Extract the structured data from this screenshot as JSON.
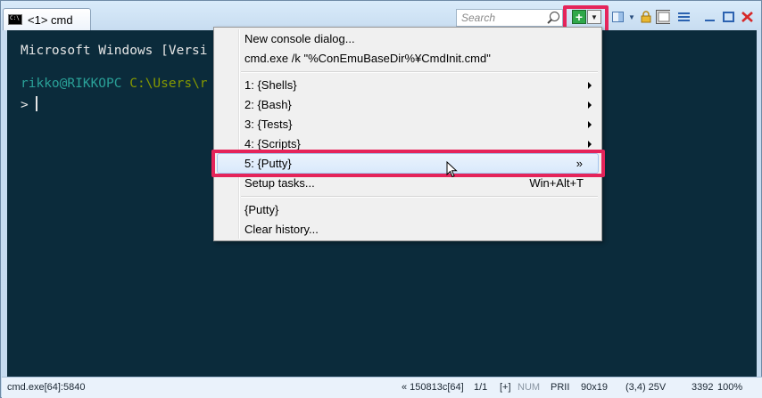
{
  "window": {
    "tab_label": "<1> cmd",
    "search_placeholder": "Search"
  },
  "console": {
    "lines": [
      {
        "text": "Microsoft Windows [Versi",
        "color": "#e6e6e6"
      },
      {
        "user": "rikko@RIKKOPC",
        "path": "C:\\Users\\r",
        "user_color": "#2aa198",
        "path_color": "#859900"
      },
      {
        "text": "> ",
        "color": "#e6e6e6"
      }
    ]
  },
  "menu": {
    "items": [
      {
        "label": "New console dialog..."
      },
      {
        "label": "cmd.exe /k \"%ConEmuBaseDir%¥CmdInit.cmd\""
      },
      {
        "label": "1: {Shells}"
      },
      {
        "label": "2: {Bash}"
      },
      {
        "label": "3: {Tests}"
      },
      {
        "label": "4: {Scripts}"
      },
      {
        "label": "5: {Putty}",
        "suffix": "»"
      },
      {
        "label": "Setup tasks...",
        "shortcut": "Win+Alt+T"
      },
      {
        "label": "{Putty}"
      },
      {
        "label": "Clear history..."
      }
    ]
  },
  "status": {
    "process": "cmd.exe[64]:5840",
    "build": "« 150813c[64]",
    "pos": "1/1",
    "plus": "[+]",
    "num": "NUM",
    "prii": "PRII",
    "size": "90x19",
    "cursor": "(3,4) 25V",
    "pid": "3392",
    "zoom": "100%"
  },
  "colors": {
    "console_bg": "#0b2b3b",
    "highlight": "#e5245a",
    "new_console_green": "#2fa84a"
  }
}
